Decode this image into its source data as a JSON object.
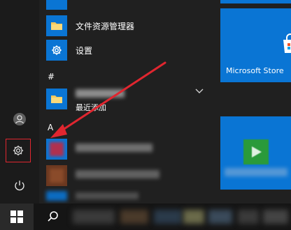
{
  "app_list": {
    "items": [
      {
        "label": "文件资源管理器",
        "icon": "folder-icon"
      },
      {
        "label": "设置",
        "icon": "gear-icon"
      }
    ],
    "section_hash": "#",
    "recent_badge": "最近添加",
    "section_a": "A"
  },
  "tiles": {
    "store_label": "Microsoft Store"
  },
  "colors": {
    "accent": "#0a75d4",
    "annotation": "#e0262f",
    "background": "#202020",
    "taskbar": "#151515"
  }
}
